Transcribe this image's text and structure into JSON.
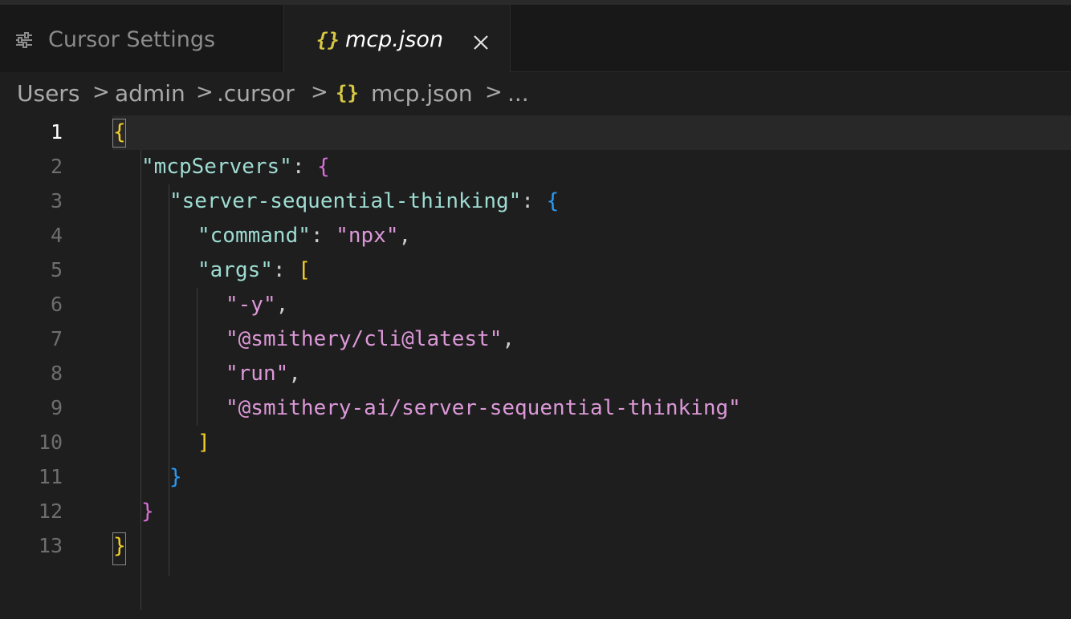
{
  "tabs": {
    "settings": {
      "label": "Cursor Settings",
      "icon": "settings-sliders-icon"
    },
    "active": {
      "label": "mcp.json",
      "icon": "json-braces-icon",
      "braces": "{}",
      "close_icon": "close-icon"
    }
  },
  "breadcrumb": {
    "items": [
      "Users",
      "admin",
      ".cursor",
      "mcp.json",
      "..."
    ],
    "separator": ">",
    "file_icon": "{}"
  },
  "editor": {
    "active_line": "1",
    "line_numbers": [
      "1",
      "2",
      "3",
      "4",
      "5",
      "6",
      "7",
      "8",
      "9",
      "10",
      "11",
      "12",
      "13"
    ],
    "tokens": {
      "l1_open": "{",
      "l2_key": "\"mcpServers\"",
      "l2_colon": ": ",
      "l2_brace": "{",
      "l3_key": "\"server-sequential-thinking\"",
      "l3_colon": ": ",
      "l3_brace": "{",
      "l4_key": "\"command\"",
      "l4_colon": ": ",
      "l4_val": "\"npx\"",
      "l4_comma": ",",
      "l5_key": "\"args\"",
      "l5_colon": ": ",
      "l5_bracket": "[",
      "l6_val": "\"-y\"",
      "l6_comma": ",",
      "l7_val": "\"@smithery/cli@latest\"",
      "l7_comma": ",",
      "l8_val": "\"run\"",
      "l8_comma": ",",
      "l9_val": "\"@smithery-ai/server-sequential-thinking\"",
      "l10_bracket": "]",
      "l11_brace": "}",
      "l12_brace": "}",
      "l13_close": "}"
    }
  },
  "colors": {
    "background": "#1e1e1e",
    "key": "#9edcd2",
    "string": "#dc98d8",
    "bracket_level1": "#f5d02b",
    "bracket_level2": "#d870d6",
    "bracket_level3": "#2b9af3",
    "json_icon": "#d7c843"
  }
}
